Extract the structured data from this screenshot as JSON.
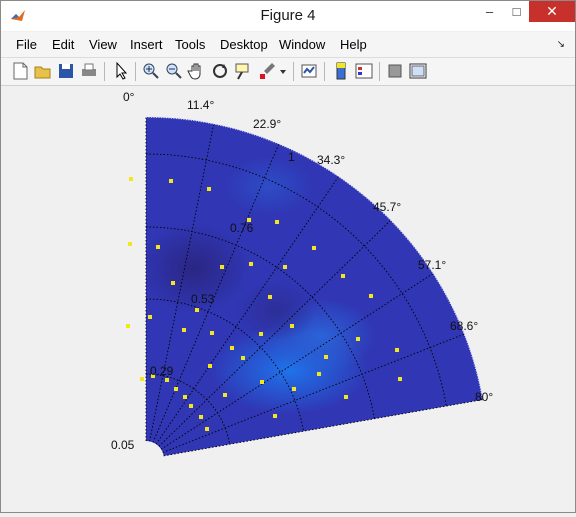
{
  "window": {
    "title": "Figure 4"
  },
  "titlebar_buttons": {
    "minimize": "–",
    "maximize": "□",
    "close": "✕"
  },
  "menu": [
    "File",
    "Edit",
    "View",
    "Insert",
    "Tools",
    "Desktop",
    "Window",
    "Help"
  ],
  "menu_dock_arrow": "↘",
  "toolbar_icons": [
    "new-figure-icon",
    "open-file-icon",
    "save-icon",
    "print-icon",
    "pointer-icon",
    "zoom-in-icon",
    "zoom-out-icon",
    "pan-hand-icon",
    "rotate-3d-icon",
    "data-cursor-icon",
    "brush-icon",
    "dropdown-arrow-icon",
    "link-plot-icon",
    "colorbar-icon",
    "legend-icon",
    "hide-plot-tools-icon",
    "show-plot-tools-icon"
  ],
  "plot": {
    "angle_labels": [
      "0°",
      "11.4°",
      "22.9°",
      "34.3°",
      "45.7°",
      "57.1°",
      "68.6°",
      "80°"
    ],
    "radius_labels": [
      "0.05",
      "0.29",
      "0.53",
      "0.76",
      "1"
    ],
    "colors": {
      "field": "#3036b4",
      "field_dark": "#2a2b8e",
      "field_light": "#1f6fe6",
      "markers": "#f2e61e",
      "grid": "#000000"
    }
  }
}
